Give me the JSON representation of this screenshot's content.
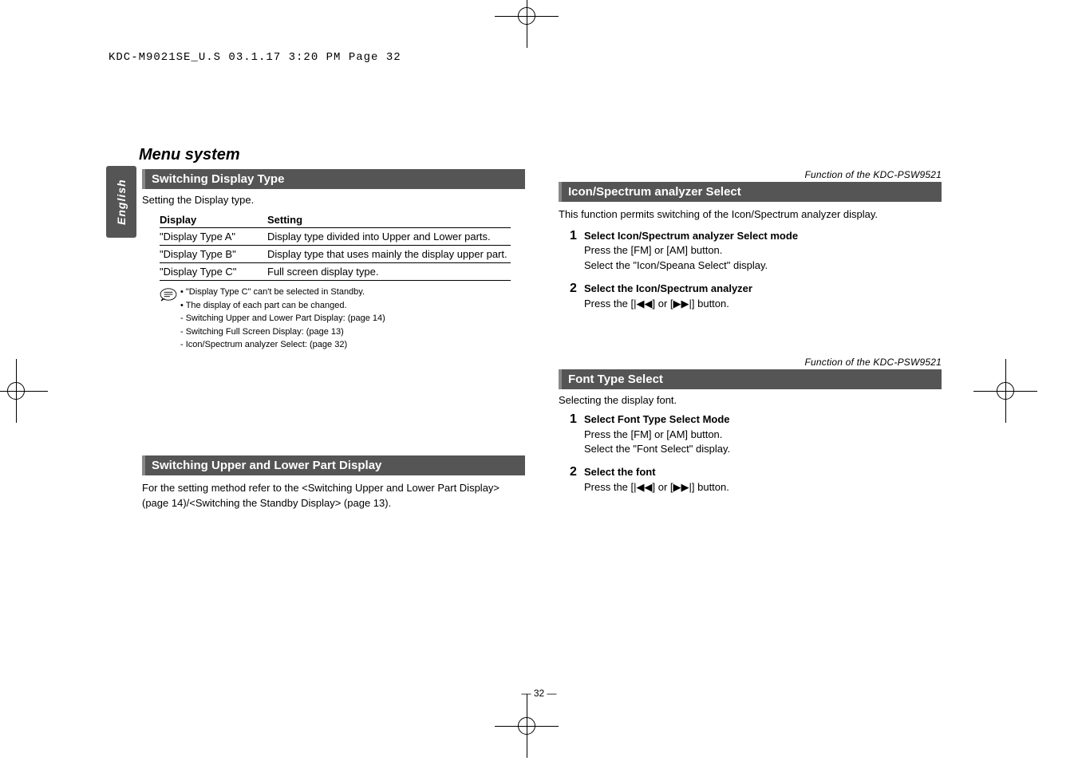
{
  "header_line": "KDC-M9021SE_U.S  03.1.17  3:20 PM  Page 32",
  "side_tab": "English",
  "page_title": "Menu system",
  "page_number": "— 32 —",
  "left": {
    "sec1": {
      "head": "Switching Display Type",
      "intro": "Setting the Display type.",
      "th1": "Display",
      "th2": "Setting",
      "rows": [
        {
          "c1": "\"Display Type A\"",
          "c2": "Display type divided into Upper and Lower parts."
        },
        {
          "c1": "\"Display Type B\"",
          "c2": "Display type that uses mainly the display upper part."
        },
        {
          "c1": "\"Display Type C\"",
          "c2": "Full screen display type."
        }
      ],
      "notes": [
        "• \"Display Type C\" can't be selected in Standby.",
        "• The display of each part can be changed.",
        "  - Switching Upper and Lower Part Display: (page 14)",
        "  - Switching Full Screen Display: (page 13)",
        "  - Icon/Spectrum analyzer Select: (page 32)"
      ]
    },
    "sec2": {
      "head": "Switching Upper and Lower Part Display",
      "body": "For the setting method refer to the <Switching Upper and Lower Part Display> (page 14)/<Switching the Standby Display> (page 13)."
    }
  },
  "right": {
    "func_label": "Function of the KDC-PSW9521",
    "sec1": {
      "head": "Icon/Spectrum analyzer Select",
      "intro": "This function permits switching of the Icon/Spectrum analyzer display.",
      "step1_num": "1",
      "step1_title": "Select Icon/Spectrum analyzer Select mode",
      "step1_l1": "Press the [FM] or [AM] button.",
      "step1_l2": "Select the \"Icon/Speana Select\" display.",
      "step2_num": "2",
      "step2_title": "Select the Icon/Spectrum analyzer",
      "step2_l1": "Press the [|◀◀] or [▶▶|] button."
    },
    "sec2": {
      "head": "Font Type Select",
      "intro": "Selecting the display font.",
      "step1_num": "1",
      "step1_title": "Select Font Type Select Mode",
      "step1_l1": "Press the [FM] or [AM] button.",
      "step1_l2": "Select the \"Font Select\" display.",
      "step2_num": "2",
      "step2_title": "Select the font",
      "step2_l1": "Press the [|◀◀] or [▶▶|] button."
    }
  }
}
